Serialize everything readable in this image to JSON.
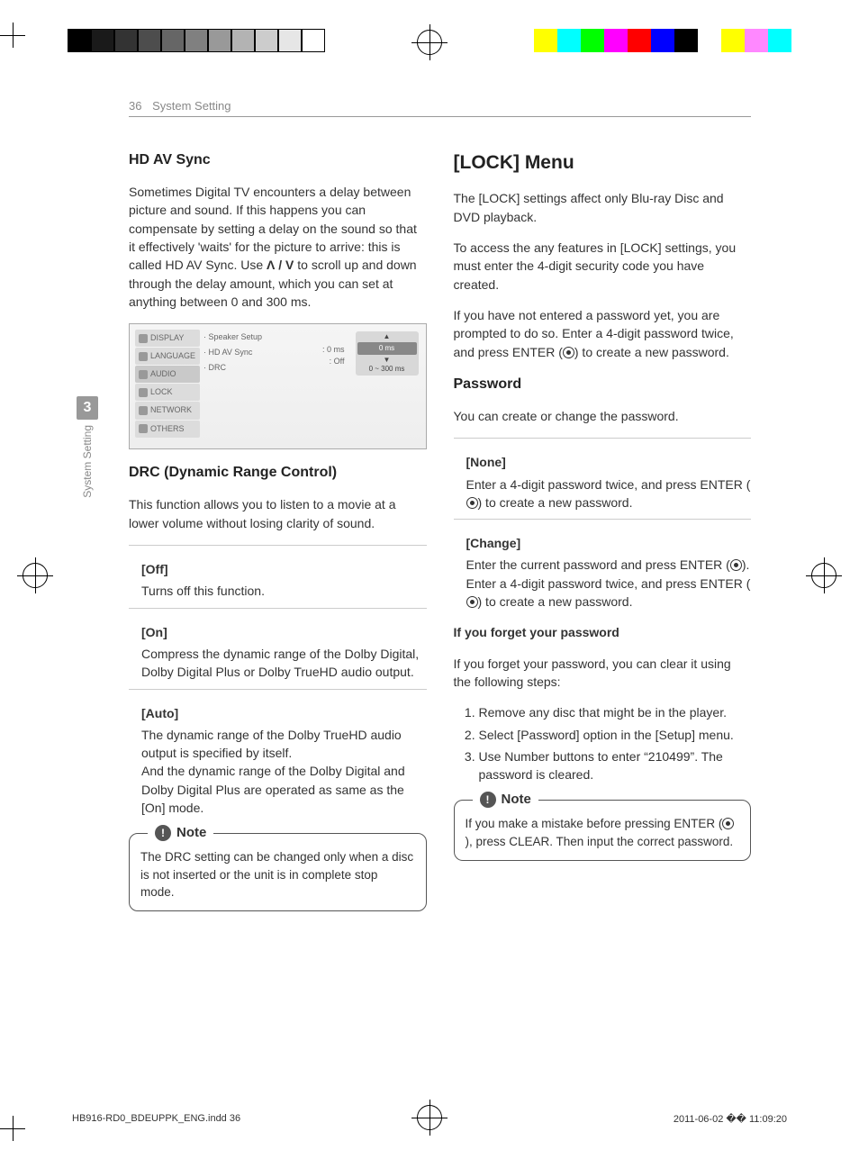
{
  "page": {
    "number": "36",
    "section": "System Setting"
  },
  "sidebar": {
    "chapter_number": "3",
    "chapter_label": "System Setting"
  },
  "left": {
    "h_hd": "HD AV Sync",
    "hd_body": "Sometimes Digital TV encounters a delay between picture and sound. If this happens you can compensate by setting a delay on the sound so that it effectively 'waits' for the picture to arrive: this is called HD AV Sync. Use ",
    "hd_body2": " to scroll up and down through the delay amount, which you can set at anything between 0 and 300 ms.",
    "arrows": "Λ / V",
    "ui": {
      "menu": [
        "DISPLAY",
        "LANGUAGE",
        "AUDIO",
        "LOCK",
        "NETWORK",
        "OTHERS"
      ],
      "opts": [
        "· Speaker Setup",
        "· HD AV Sync",
        "· DRC"
      ],
      "vals": [
        ": 0 ms",
        ": Off"
      ],
      "slider_val": "0 ms",
      "slider_range": "0 ~ 300 ms"
    },
    "h_drc": "DRC (Dynamic Range Control)",
    "drc_body": "This function allows you to listen to a movie at a lower volume without losing clarity of sound.",
    "opt_off_label": "[Off]",
    "opt_off_body": "Turns off this function.",
    "opt_on_label": "[On]",
    "opt_on_body": "Compress the dynamic range of the Dolby Digital, Dolby Digital Plus or Dolby TrueHD audio output.",
    "opt_auto_label": "[Auto]",
    "opt_auto_body": "The dynamic range of the Dolby TrueHD audio output is specified by itself.\nAnd the dynamic range of the Dolby Digital and Dolby Digital Plus are operated as same as the [On] mode.",
    "note_label": "Note",
    "note_body": "The DRC setting can be changed only when a disc is not inserted or the unit is in complete stop mode."
  },
  "right": {
    "h_lock": "[LOCK] Menu",
    "lock_p1": "The [LOCK] settings affect only Blu-ray Disc and DVD playback.",
    "lock_p2": "To access the any features in [LOCK] settings, you must enter the 4-digit security code you have created.",
    "lock_p3a": "If you have not entered a password yet, you are prompted to do so. Enter a 4-digit password twice, and press ENTER (",
    "lock_p3b": ") to create a new password.",
    "h_pw": "Password",
    "pw_body": "You can create or change the password.",
    "opt_none_label": "[None]",
    "opt_none_a": "Enter a 4-digit password twice, and press ENTER (",
    "opt_none_b": ") to create a new password.",
    "opt_change_label": "[Change]",
    "opt_change_a": "Enter the current password and press ENTER (",
    "opt_change_b": "). Enter a 4-digit password twice, and press ENTER (",
    "opt_change_c": ") to create a new password.",
    "forget_h": "If you forget your password",
    "forget_body": "If you forget your password, you can clear it using the following steps:",
    "steps": [
      "Remove any disc that might be in the player.",
      "Select [Password] option in the [Setup] menu.",
      "Use Number buttons to enter “210499”. The password is cleared."
    ],
    "note_label": "Note",
    "note_a": "If you make a mistake before pressing ENTER (",
    "note_b": "), press CLEAR. Then input the correct password."
  },
  "footer": {
    "file": "HB916-RD0_BDEUPPK_ENG.indd   36",
    "timestamp": "2011-06-02   �� 11:09:20"
  },
  "colorbars": {
    "left": [
      "#000",
      "#1a1a1a",
      "#333",
      "#4d4d4d",
      "#666",
      "#808080",
      "#999",
      "#b3b3b3",
      "#ccc",
      "#e6e6e6",
      "#fff"
    ],
    "right": [
      "#fff",
      "#ff0",
      "#0ff",
      "#0f0",
      "#f0f",
      "#f00",
      "#00f",
      "#000",
      "#fff",
      "#ff0",
      "#f8f",
      "#0ff"
    ]
  }
}
